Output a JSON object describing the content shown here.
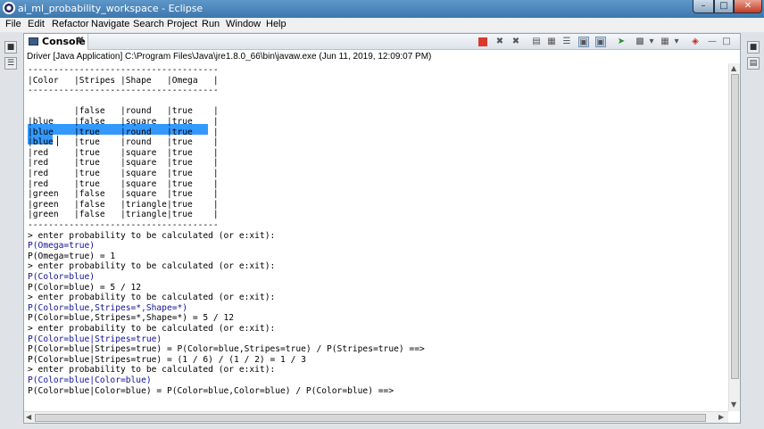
{
  "window": {
    "title": "ai_ml_probability_workspace - Eclipse"
  },
  "menu": [
    "File",
    "Edit",
    "Refactor",
    "Navigate",
    "Search",
    "Project",
    "Run",
    "Window",
    "Help"
  ],
  "console": {
    "tab_label": "Console",
    "description": "Driver [Java Application] C:\\Program Files\\Java\\jre1.8.0_66\\bin\\javaw.exe (Jun 11, 2019, 12:09:07 PM)",
    "lines": [
      {
        "text": "-------------------------------------",
        "input": false
      },
      {
        "text": "|Color   |Stripes |Shape   |Omega   |",
        "input": false
      },
      {
        "text": "-------------------------------------",
        "input": false
      },
      {
        "text": "|blue    |false   |round   |true    |",
        "input": false
      },
      {
        "text": "|blue    |false   |round   |true    |",
        "input": false
      },
      {
        "text": "|blue    |false   |square  |true    |",
        "input": false
      },
      {
        "text": "|blue    |true    |round   |true    |",
        "input": false
      },
      {
        "text": "|blue    |true    |round   |true    |",
        "input": false
      },
      {
        "text": "|red     |true    |square  |true    |",
        "input": false
      },
      {
        "text": "|red     |true    |square  |true    |",
        "input": false
      },
      {
        "text": "|red     |true    |square  |true    |",
        "input": false
      },
      {
        "text": "|red     |true    |square  |true    |",
        "input": false
      },
      {
        "text": "|green   |false   |square  |true    |",
        "input": false
      },
      {
        "text": "|green   |false   |triangle|true    |",
        "input": false
      },
      {
        "text": "|green   |false   |triangle|true    |",
        "input": false
      },
      {
        "text": "-------------------------------------",
        "input": false
      },
      {
        "text": "> enter probability to be calculated (or e:xit):",
        "input": false
      },
      {
        "text": "P(Omega=true)",
        "input": true
      },
      {
        "text": "P(Omega=true) = 1",
        "input": false
      },
      {
        "text": "> enter probability to be calculated (or e:xit):",
        "input": false
      },
      {
        "text": "P(Color=blue)",
        "input": true
      },
      {
        "text": "P(Color=blue) = 5 / 12",
        "input": false
      },
      {
        "text": "> enter probability to be calculated (or e:xit):",
        "input": false
      },
      {
        "text": "P(Color=blue,Stripes=*,Shape=*)",
        "input": true
      },
      {
        "text": "P(Color=blue,Stripes=*,Shape=*) = 5 / 12",
        "input": false
      },
      {
        "text": "> enter probability to be calculated (or e:xit):",
        "input": false
      },
      {
        "text": "P(Color=blue|Stripes=true)",
        "input": true
      },
      {
        "text": "P(Color=blue|Stripes=true) = P(Color=blue,Stripes=true) / P(Stripes=true) ==>",
        "input": false
      },
      {
        "text": "P(Color=blue|Stripes=true) = (1 / 6) / (1 / 2) = 1 / 3",
        "input": false
      },
      {
        "text": "> enter probability to be calculated (or e:xit):",
        "input": false
      },
      {
        "text": "P(Color=blue|Color=blue)",
        "input": true
      },
      {
        "text": "P(Color=blue|Color=blue) = P(Color=blue,Color=blue) / P(Color=blue) ==>",
        "input": false
      }
    ],
    "highlight_color": "#3399ff",
    "input_text_color": "#10109a"
  }
}
